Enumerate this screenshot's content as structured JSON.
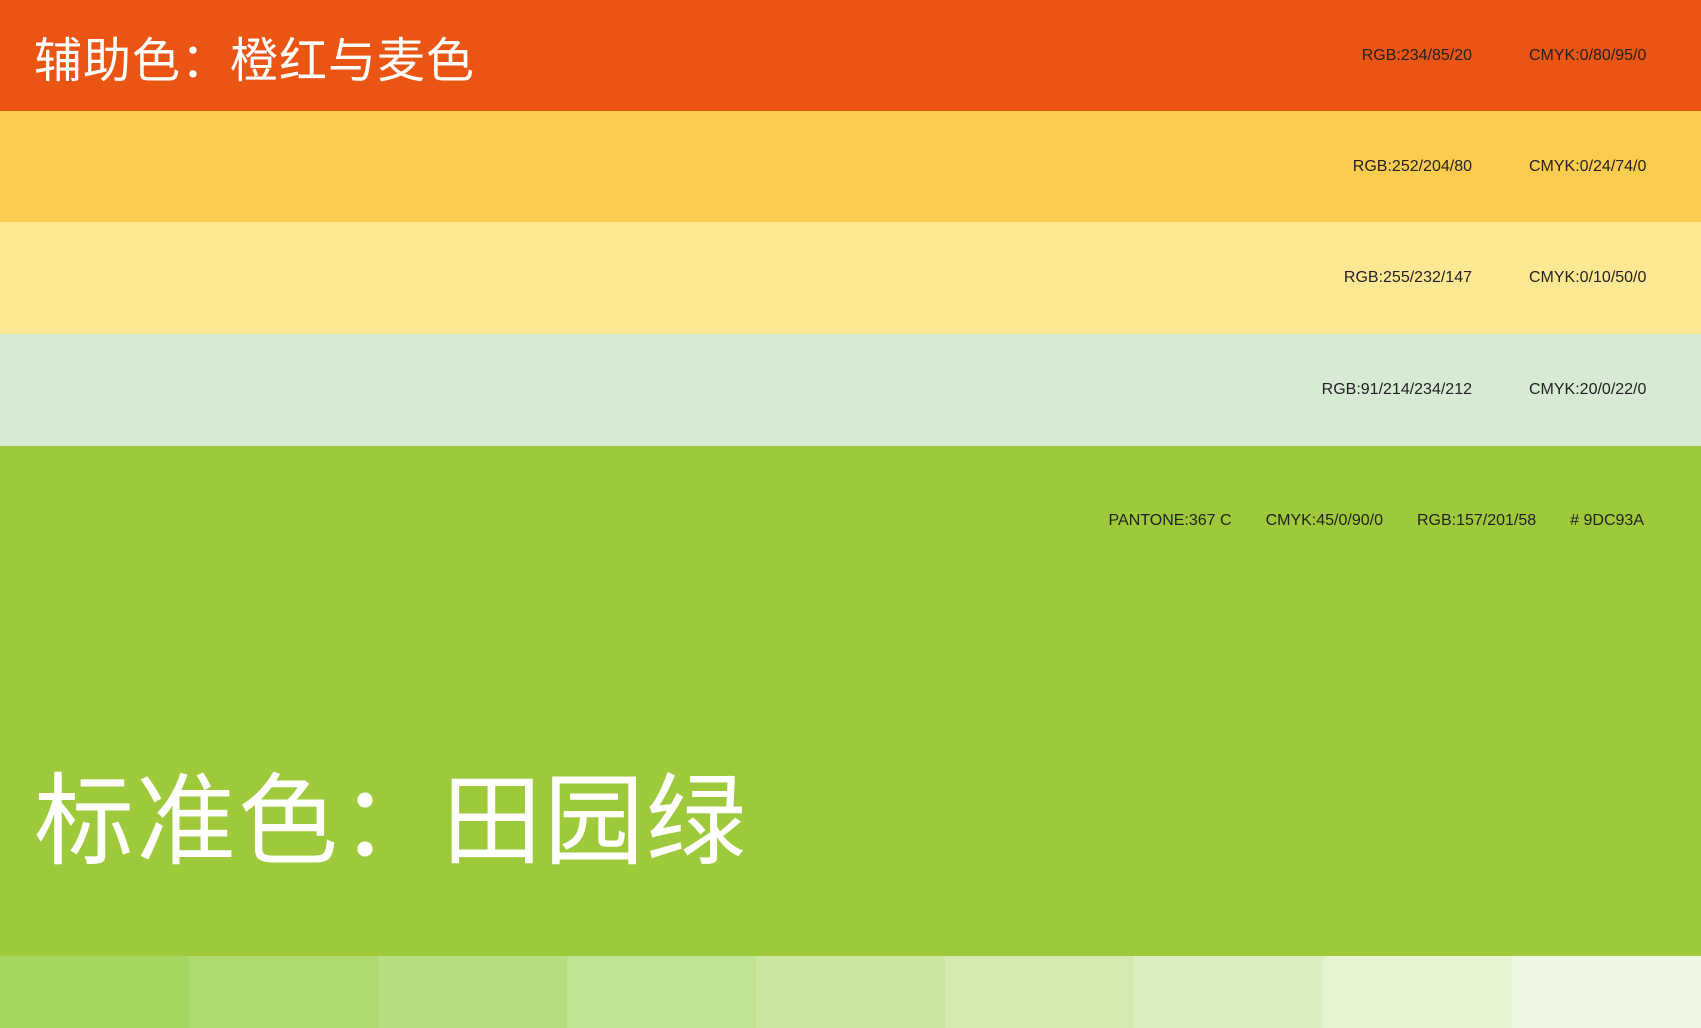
{
  "accent": {
    "title": "辅助色：橙红与麦色",
    "bands": [
      {
        "id": "orange",
        "color": "#EA5514",
        "rgb": "RGB:234/85/20",
        "cmyk": "CMYK:0/80/95/0"
      },
      {
        "id": "yellow",
        "color": "#FCCC50",
        "rgb": "RGB:252/204/80",
        "cmyk": "CMYK:0/24/74/0"
      },
      {
        "id": "cream",
        "color": "#FFE893",
        "rgb": "RGB:255/232/147",
        "cmyk": "CMYK:0/10/50/0"
      },
      {
        "id": "mint",
        "color": "#D6EAD4",
        "rgb": "RGB:91/214/234/212",
        "cmyk": "CMYK:20/0/22/0"
      }
    ]
  },
  "standard": {
    "title": "标准色：田园绿",
    "color": "#9DC93A",
    "pantone": "PANTONE:367 C",
    "cmyk": "CMYK:45/0/90/0",
    "rgb": "RGB:157/201/58",
    "hex": "# 9DC93A"
  },
  "tints": [
    "#A5D661",
    "#AFDA71",
    "#B8DE81",
    "#C1E291",
    "#CAE7A1",
    "#D3EBB1",
    "#DCEFC1",
    "#E5F3D1",
    "#EEF7E2"
  ]
}
